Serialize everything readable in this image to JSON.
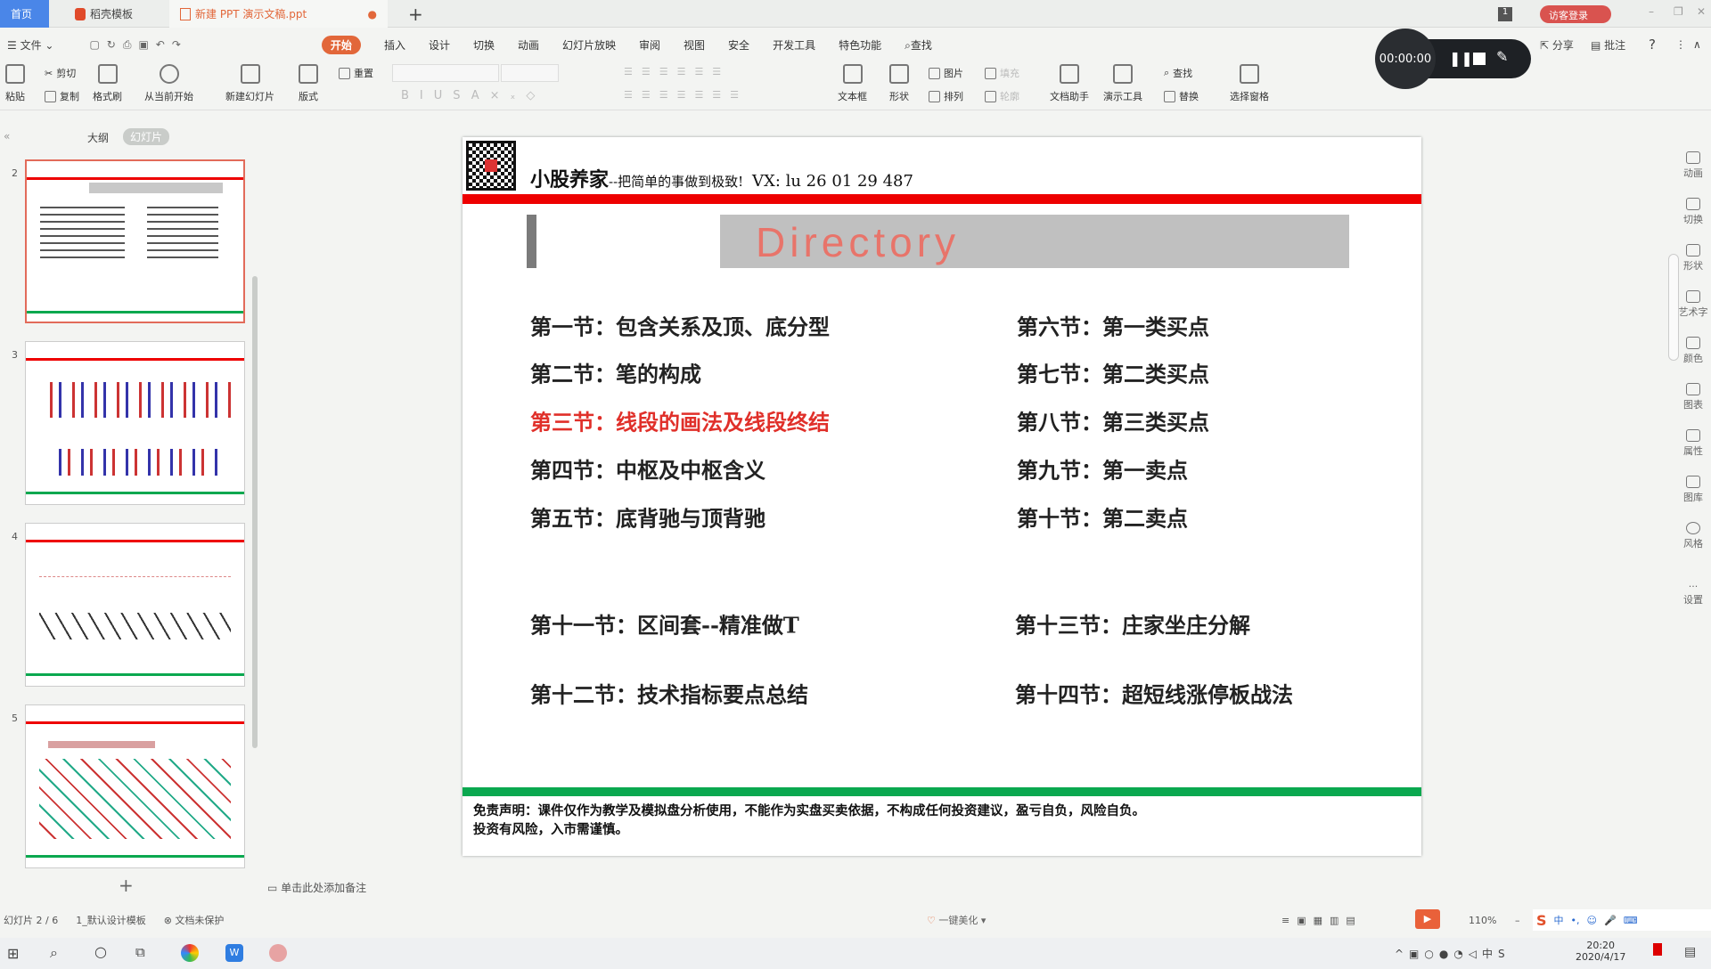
{
  "tabs": {
    "home": "首页",
    "template": "稻壳模板",
    "doc": "新建 PPT 演示文稿.ppt",
    "new_tab": "+",
    "badge": "1",
    "login": "访客登录"
  },
  "menu": {
    "file": "文件",
    "items": [
      "开始",
      "插入",
      "设计",
      "切换",
      "动画",
      "幻灯片放映",
      "审阅",
      "视图",
      "安全",
      "开发工具",
      "特色功能"
    ],
    "search": "查找",
    "share": "分享",
    "comment": "批注",
    "help": "?"
  },
  "recorder": {
    "time": "00:00:00"
  },
  "ribbon": {
    "paste": "粘贴",
    "cut": "剪切",
    "copy": "复制",
    "format_painter": "格式刷",
    "from_current": "从当前开始",
    "new_slide": "新建幻灯片",
    "layout": "版式",
    "reset": "重置",
    "textbox": "文本框",
    "shape": "形状",
    "picture": "图片",
    "fill": "填充",
    "arrange": "排列",
    "outline": "轮廓",
    "doc_assistant": "文档助手",
    "present_tools": "演示工具",
    "find": "查找",
    "replace": "替换",
    "select_pane": "选择窗格"
  },
  "leftpanel": {
    "outline_tab": "大纲",
    "slides_tab": "幻灯片",
    "thumbs": [
      "2",
      "3",
      "4",
      "5"
    ],
    "add": "+"
  },
  "slide": {
    "brand": "小股养家",
    "slogan": "--把简单的事做到极致!",
    "vx": "VX: lu 26 01 29 487",
    "heading": "Directory",
    "left_items": [
      "第一节：包含关系及顶、底分型",
      "第二节：笔的构成",
      "第三节：线段的画法及线段终结",
      "第四节：中枢及中枢含义",
      "第五节：底背驰与顶背驰",
      "第十一节：区间套--精准做T",
      "第十二节：技术指标要点总结"
    ],
    "right_items": [
      "第六节：第一类买点",
      "第七节：第二类买点",
      "第八节：第三类买点",
      "第九节：第一卖点",
      "第十节：第二卖点",
      "第十三节：庄家坐庄分解",
      "第十四节：超短线涨停板战法"
    ],
    "highlight_color": "#e0302a",
    "disclaimer1": "免责声明：课件仅作为教学及模拟盘分析使用，不能作为实盘买卖依据，不构成任何投资建议，盈亏自负，风险自负。",
    "disclaimer2": "投资有风险，入市需谨慎。"
  },
  "notes": {
    "placeholder": "单击此处添加备注"
  },
  "status": {
    "slide": "幻灯片 2 / 6",
    "theme": "1_默认设计模板",
    "protect": "文档未保护",
    "beautify": "一键美化",
    "zoom": "110%"
  },
  "rightbar": [
    "动画",
    "切换",
    "形状",
    "艺术字",
    "颜色",
    "图表",
    "属性",
    "图库",
    "风格",
    "设置"
  ],
  "taskbar": {
    "time": "20:20",
    "date": "2020/4/17",
    "ime": "中"
  },
  "colors": {
    "accent": "#e2673a",
    "red_bar": "#ee0000",
    "green_bar": "#0aa84f",
    "home_tab": "#4a86e8"
  }
}
